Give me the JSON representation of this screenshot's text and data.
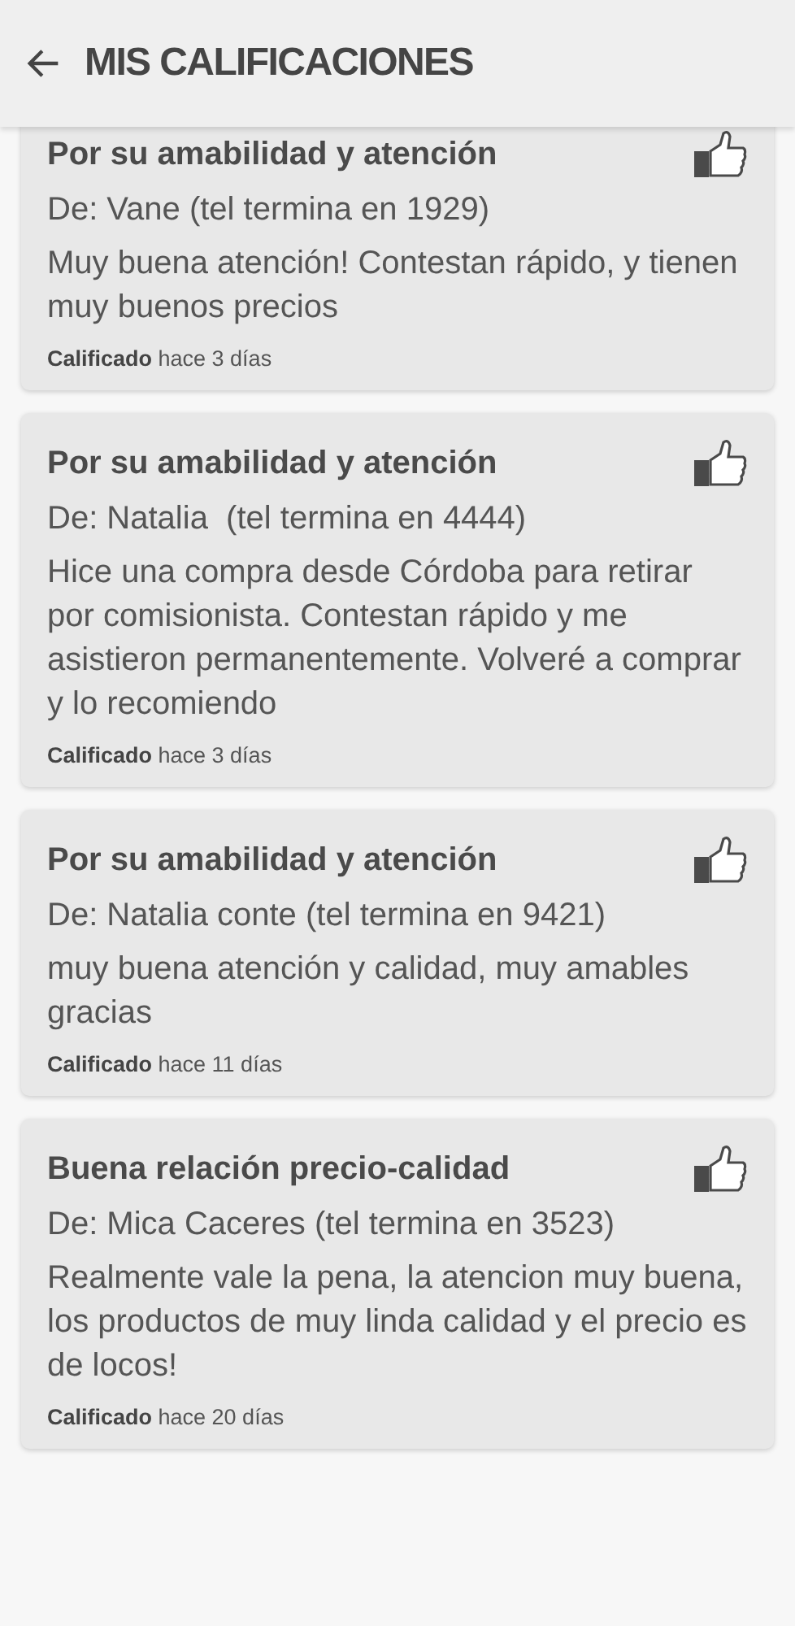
{
  "header": {
    "title": "MIS CALIFICACIONES"
  },
  "reviews": [
    {
      "title": "Por su amabilidad y atención",
      "from": "De: Vane (tel termina en 1929)",
      "comment": "Muy buena atención! Contestan rápido, y tienen muy buenos precios",
      "rated": "**Calificado** hace 3 días"
    },
    {
      "title": "Por su amabilidad y atención",
      "from": "De: Natalia  (tel termina en 4444)",
      "comment": "Hice una compra desde Córdoba para retirar por comisionista. Contestan rápido y me asistieron permanentemente. Volveré a comprar y lo recomiendo",
      "rated": "**Calificado** hace 3 días"
    },
    {
      "title": "Por su amabilidad y atención",
      "from": "De: Natalia conte (tel termina en 9421)",
      "comment": "muy buena atención y calidad, muy amables gracias",
      "rated": "**Calificado** hace 11 días"
    },
    {
      "title": "Buena relación precio-calidad",
      "from": "De: Mica Caceres (tel termina en 3523)",
      "comment": "Realmente vale la pena, la atencion muy buena, los productos de muy linda calidad y el precio es de locos!",
      "rated": "**Calificado** hace 20 días"
    }
  ]
}
